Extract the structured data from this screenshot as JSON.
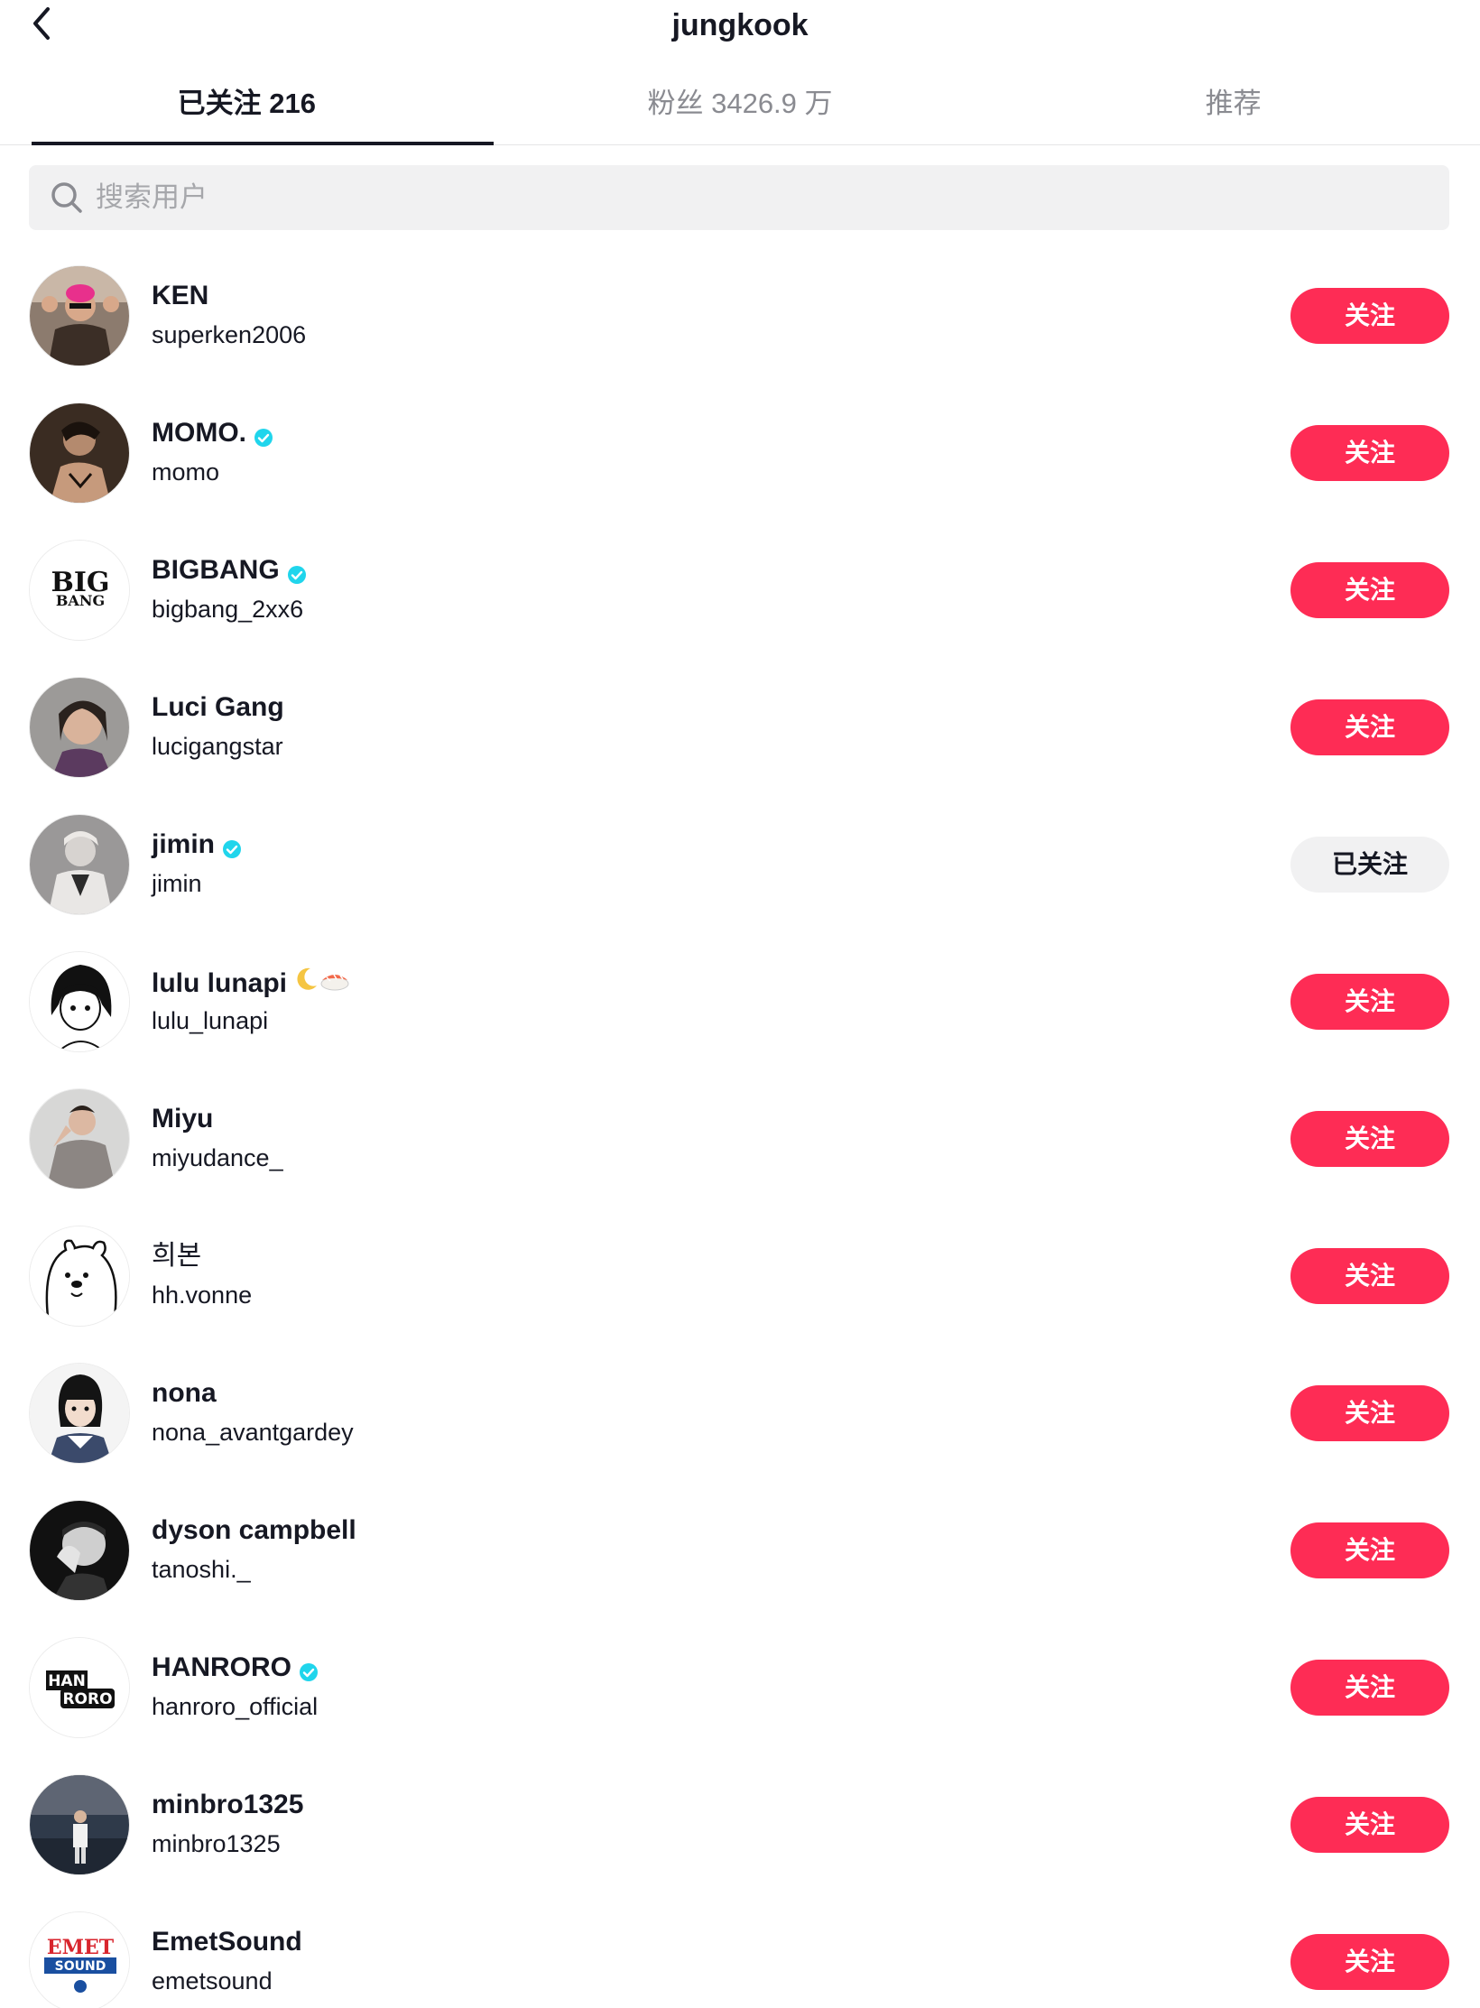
{
  "header": {
    "title": "jungkook",
    "back_icon": "chevron-left-icon"
  },
  "tabs": [
    {
      "label": "已关注 216",
      "active": true
    },
    {
      "label": "粉丝 3426.9 万",
      "active": false
    },
    {
      "label": "推荐",
      "active": false
    }
  ],
  "search": {
    "placeholder": "搜索用户",
    "icon": "search-icon"
  },
  "colors": {
    "accent": "#fe2c55",
    "verified": "#20d5ec",
    "following_bg": "#f1f1f2"
  },
  "users": [
    {
      "name": "KEN",
      "handle": "superken2006",
      "verified": false,
      "button": "关注",
      "following": false
    },
    {
      "name": "MOMO.",
      "handle": "momo",
      "verified": true,
      "button": "关注",
      "following": false
    },
    {
      "name": "BIGBANG",
      "handle": "bigbang_2xx6",
      "verified": true,
      "button": "关注",
      "following": false
    },
    {
      "name": "Luci Gang",
      "handle": "lucigangstar",
      "verified": false,
      "button": "关注",
      "following": false
    },
    {
      "name": "jimin",
      "handle": "jimin",
      "verified": true,
      "button": "已关注",
      "following": true
    },
    {
      "name": "lulu lunapi",
      "handle": "lulu_lunapi",
      "verified": false,
      "button": "关注",
      "following": false,
      "emoji": [
        "moon-emoji",
        "sushi-emoji"
      ]
    },
    {
      "name": "Miyu",
      "handle": "miyudance_",
      "verified": false,
      "button": "关注",
      "following": false
    },
    {
      "name": "희본",
      "handle": "hh.vonne",
      "verified": false,
      "button": "关注",
      "following": false
    },
    {
      "name": "nona",
      "handle": "nona_avantgardey",
      "verified": false,
      "button": "关注",
      "following": false
    },
    {
      "name": "dyson campbell",
      "handle": "tanoshi._",
      "verified": false,
      "button": "关注",
      "following": false
    },
    {
      "name": "HANRORO",
      "handle": "hanroro_official",
      "verified": true,
      "button": "关注",
      "following": false
    },
    {
      "name": "minbro1325",
      "handle": "minbro1325",
      "verified": false,
      "button": "关注",
      "following": false
    },
    {
      "name": "EmetSound",
      "handle": "emetsound",
      "verified": false,
      "button": "关注",
      "following": false
    }
  ],
  "avatar_logos": {
    "bigbang": [
      "BIG",
      "BANG"
    ],
    "hanroro": [
      "HAN",
      "RORO"
    ],
    "emetsound": [
      "EMET",
      "SOUND"
    ]
  }
}
